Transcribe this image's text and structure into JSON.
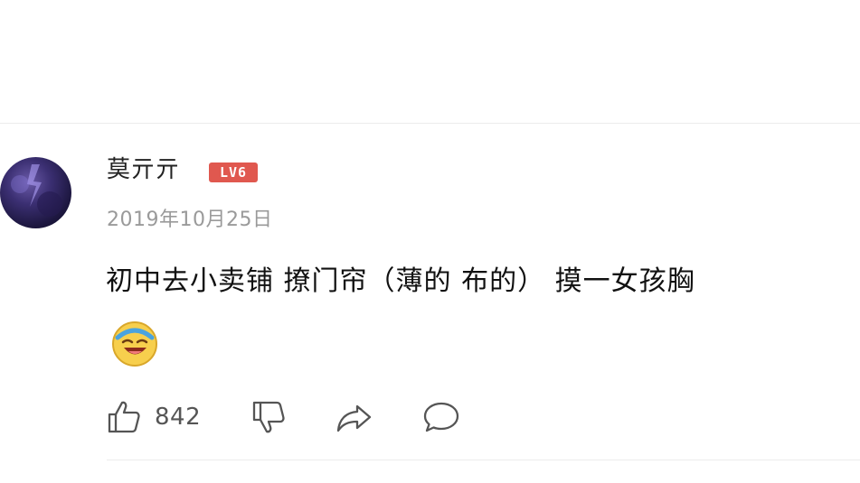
{
  "comment": {
    "username": "莫亓亓",
    "level_badge": "LV6",
    "date": "2019年10月25日",
    "text": "初中去小卖铺  撩门帘（薄的 布的） 摸一女孩胸",
    "emoji": "laughing-crying-face-emoji"
  },
  "actions": {
    "like_count": "842",
    "icons": [
      "thumbs-up-icon",
      "thumbs-down-icon",
      "share-icon",
      "reply-icon"
    ]
  },
  "colors": {
    "badge": "#e0584f",
    "username": "#222222",
    "date": "#9a9a9a",
    "text": "#111111",
    "icon": "#555555",
    "avatar": "#3b2f72"
  }
}
